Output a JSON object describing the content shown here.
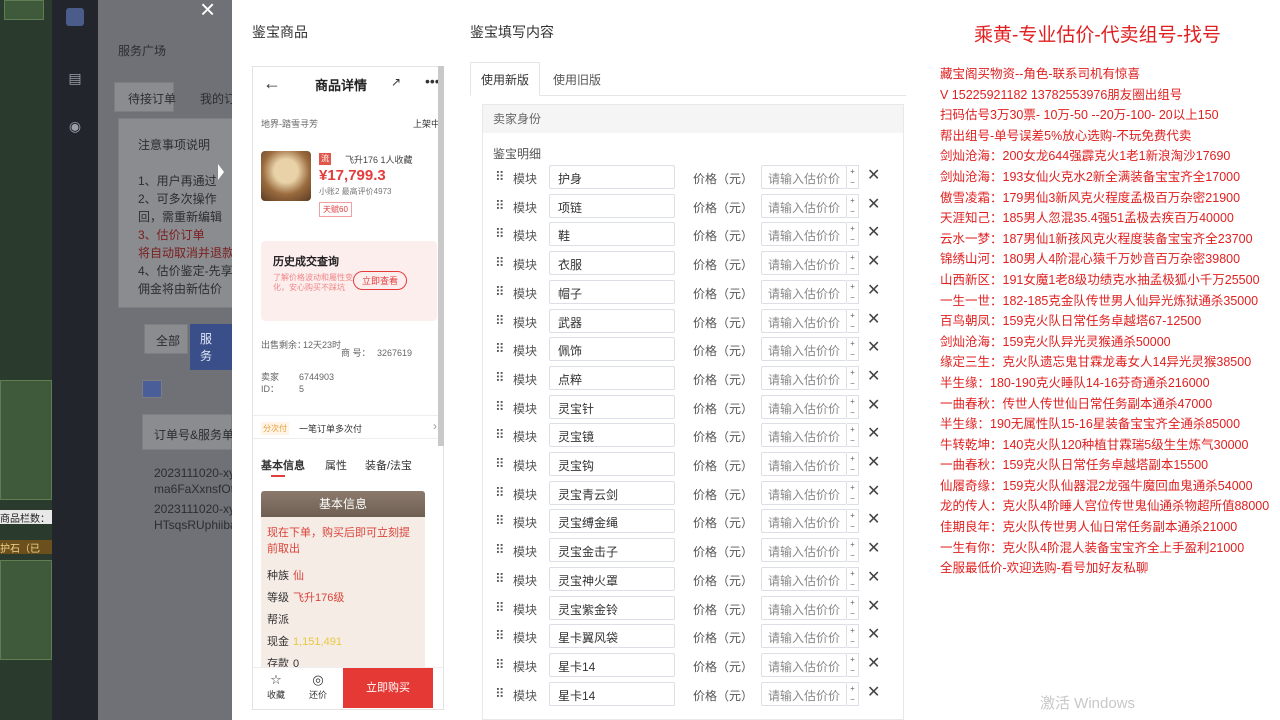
{
  "background": {
    "bottom_label": "商品栏数：",
    "bottom_tag": "护石（已",
    "sidebar_icons": [
      "logo-icon",
      "chart-icon",
      "user-icon"
    ],
    "page_texts": [
      "服务广场",
      "待接订单",
      "我的订",
      "注意事项说明",
      "1、用户再通过",
      "2、可多次操作",
      "回，需重新编辑",
      "3、估价订单",
      "将自动取消并退款",
      "4、估价鉴定-先享",
      "佣金将由新估价",
      "全部",
      "服务",
      "订单号&服务单",
      "2023111020-xy",
      "ma6FaXxnsfOt",
      "2023111020-xy",
      "HTsqsRUphiiba"
    ]
  },
  "modal": {
    "left_title": "鉴宝商品",
    "right_title": "鉴宝填写内容",
    "phone": {
      "nav_title": "商品详情",
      "share_icon": "share-icon",
      "loc": "地界-踏雪寻芳",
      "shelf": "上架中",
      "quick_tag": "流",
      "level": "飞升176  1人收藏",
      "price": "¥17,799.3",
      "sub": "小账2  最高评价4973",
      "badge": "天赋60",
      "hist_title": "历史成交查询",
      "hist_note": "了解价格波动和屬性变化，安心购买不踩坑",
      "hist_btn": "立即查看",
      "sale_date_label": "出售剩余：",
      "sale_date_value": "12天23时",
      "goods_no_label": "商 号：",
      "goods_no_value": "3267619",
      "seller_id_label": "卖家ID：",
      "seller_id_value": "6744903 5",
      "strip_tag": "分次付",
      "strip_text": "一笔订单多次付",
      "strip_arrow": "›",
      "tab_basic": "基本信息",
      "tab_attr": "属性",
      "tab_equip": "装备/法宝",
      "card_title": "基本信息",
      "card_note": "现在下单，购买后即可立刻提前取出",
      "race_label": "种族",
      "race_value": "仙",
      "grade_label": "等级",
      "grade_value": "飞升176级",
      "sect_label": "帮派",
      "sect_value": "",
      "cash_label": "现金",
      "cash_value": "1,151,491",
      "save_label": "存款",
      "save_value": "0",
      "fav_label": "收藏",
      "bargain_label": "还价",
      "buy_label": "立即购买"
    },
    "form": {
      "tab_new": "使用新版",
      "tab_old": "使用旧版",
      "seller_section": "卖家身份",
      "detail_label": "鉴宝明细",
      "module_label": "模块",
      "price_label": "价格（元）",
      "price_placeholder": "请输入估价价",
      "items": [
        "护身",
        "项链",
        "鞋",
        "衣服",
        "帽子",
        "武器",
        "佩饰",
        "点粹",
        "灵宝针",
        "灵宝镜",
        "灵宝钩",
        "灵宝青云剑",
        "灵宝缚金绳",
        "灵宝金击子",
        "灵宝神火罩",
        "灵宝紫金铃",
        "星卡翼风袋",
        "星卡14",
        "星卡14"
      ]
    }
  },
  "ad": {
    "title": "乘黄-专业估价-代卖组号-找号",
    "lines": [
      "藏宝阁买物资--角色-联系司机有惊喜",
      "V 15225921182  13782553976朋友圈出组号",
      "扫码估号3万30票- 10万-50 --20万-100- 20以上150",
      "帮出组号-单号误差5%放心选购-不玩免费代卖",
      "剑灿沧海：200女龙644强霹克火1老1新浪淘沙17690",
      "剑灿沧海：193女仙火克水2新全满装备宝宝齐全17000",
      "傲雪凌霜：179男仙3新风克火程度孟极百万杂密21900",
      "天涯知己：185男人忽混35.4强51孟极去疾百万40000",
      "云水一梦：187男仙1新孩风克火程度装备宝宝齐全23700",
      "锦绣山河：180男人4阶混心猿千万妙音百万杂密39800",
      "山西新区：191女魔1老8级功绩克水抽孟极狐小千万25500",
      "一生一世：182-185克金队传世男人仙异光炼狱通杀35000",
      "百鸟朝凤：159克火队日常任务卓越塔67-12500",
      "剑灿沧海：159克火队异光灵猴通杀50000",
      "缘定三生：克火队遗忘鬼甘霖龙毒女人14异光灵猴38500",
      "半生缘：180-190克火睡队14-16芬奇通杀216000",
      "一曲春秋：传世人传世仙日常任务副本通杀47000",
      "半生缘：190无属性队15-16星装备宝宝齐全通杀85000",
      "牛转乾坤：140克火队120种植甘霖瑞5级生生炼气30000",
      "一曲春秋：159克火队日常任务卓越塔副本15500",
      "仙履奇缘：159克火队仙器混2龙强牛魔回血鬼通杀54000",
      "龙的传人：克火队4阶睡人宫位传世鬼仙通杀物超所值88000",
      "佳期良年：克火队传世男人仙日常任务副本通杀21000",
      "一生有你：克火队4阶混人装备宝宝齐全上手盈利21000",
      "全服最低价-欢迎选购-看号加好友私聊"
    ],
    "watermark": "激活 Windows"
  }
}
